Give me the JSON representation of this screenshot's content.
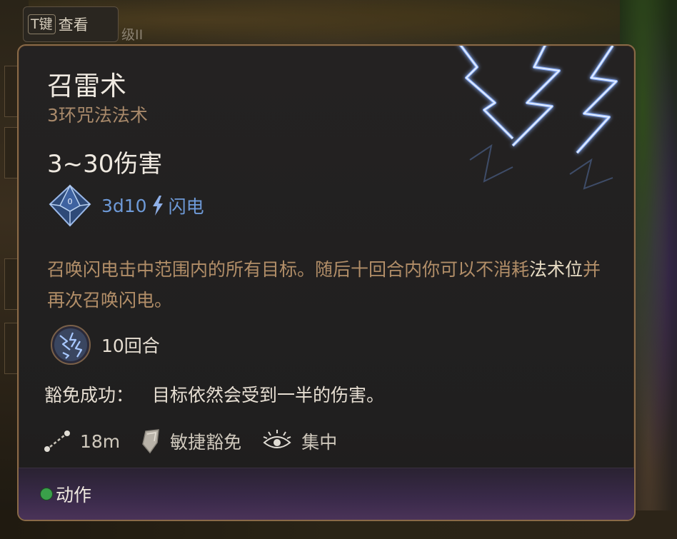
{
  "hint": {
    "key": "T键",
    "label": "查看",
    "ghost_text": "级II"
  },
  "spell": {
    "name": "召雷术",
    "level_school": "3环咒法法术",
    "damage_range": "3~30伤害",
    "damage_dice": "3d10",
    "damage_type": "闪电",
    "description_part1": "召唤闪电击中范围内的所有目标。随后十回合内你可以不消耗",
    "description_keyword": "法术位",
    "description_part2": "并再次召唤闪电。",
    "duration": "10回合",
    "save_label": "豁免成功：",
    "save_effect": "目标依然会受到一半的伤害。",
    "range": "18m",
    "save_type": "敏捷豁免",
    "concentration": "集中",
    "action_type": "动作"
  },
  "colors": {
    "title": "#efe9e0",
    "subtitle": "#a8896a",
    "lightning_text": "#6e9ad8",
    "description": "#b28e68",
    "border": "#8a6a48",
    "action_dot": "#3aa04a"
  },
  "icons": {
    "dice": "d10-die-icon",
    "damage_type": "lightning-bolt-icon",
    "duration": "storm-duration-icon",
    "range": "range-icon",
    "save": "shield-save-icon",
    "concentration": "concentration-eye-icon",
    "action": "action-dot-icon"
  }
}
